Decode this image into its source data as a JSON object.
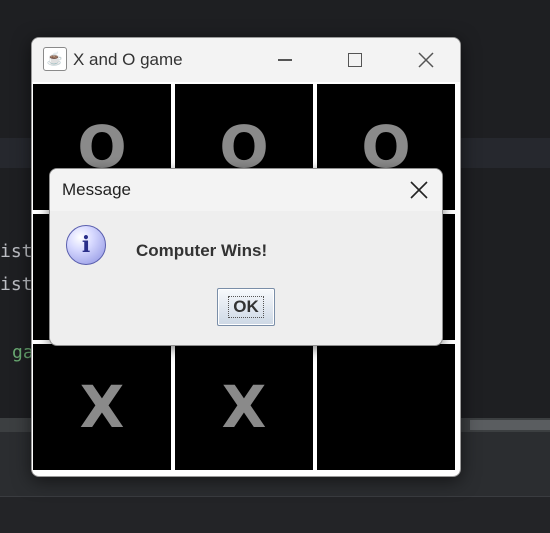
{
  "ide": {
    "code_lines": [
      "ist",
      "ist",
      "ga"
    ]
  },
  "window": {
    "title": "X and O game",
    "icon": "java-cup-icon",
    "controls": [
      "minimize-icon",
      "maximize-icon",
      "close-icon"
    ]
  },
  "board": {
    "cells": [
      [
        "O",
        "O",
        "O"
      ],
      [
        "",
        "",
        ""
      ],
      [
        "X",
        "X",
        ""
      ]
    ],
    "cell_bg": "#000000",
    "mark_color": "#8a8a8a"
  },
  "dialog": {
    "title": "Message",
    "icon": "info-icon",
    "icon_glyph": "i",
    "message": "Computer Wins!",
    "ok_label": "OK"
  }
}
